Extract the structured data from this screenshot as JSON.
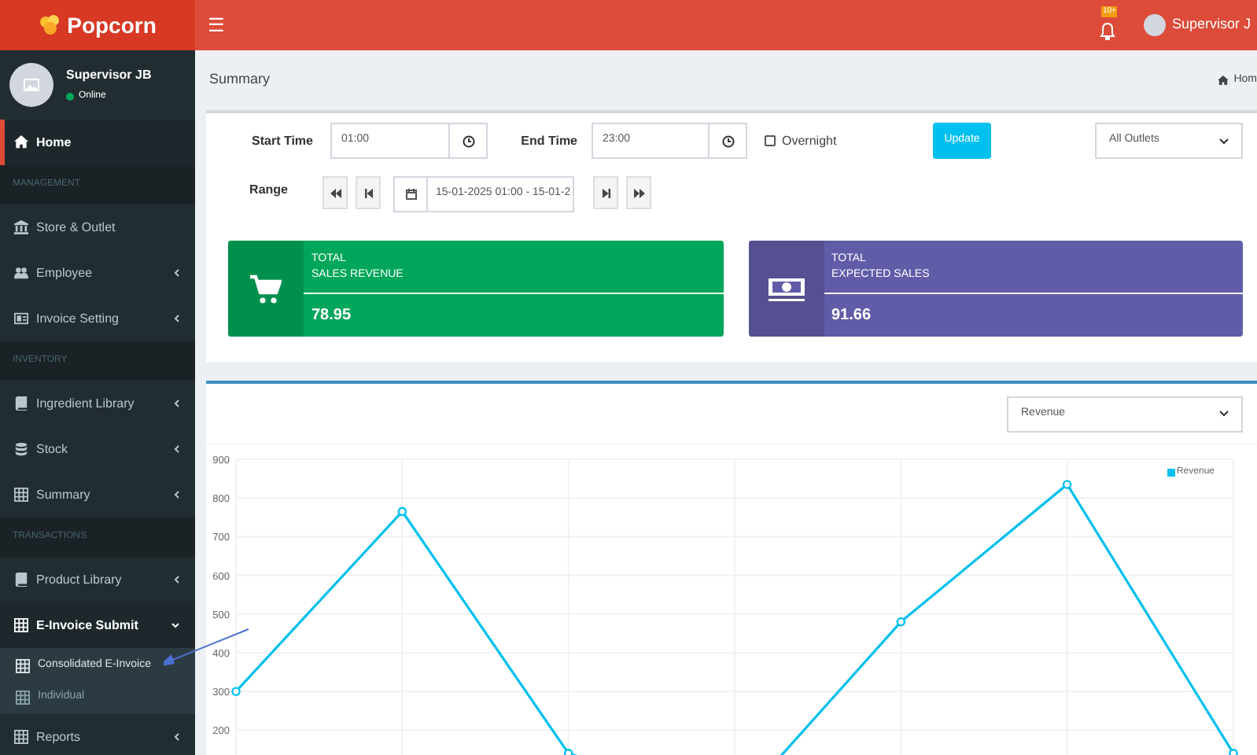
{
  "header": {
    "logo": "Popcorn",
    "menu_toggle": "☰",
    "notifications_badge": "10+",
    "user_name": "Supervisor J"
  },
  "sidebar": {
    "user": {
      "name": "Supervisor JB",
      "status": "Online"
    },
    "items": [
      {
        "kind": "item",
        "label": "Home",
        "selected": true,
        "has_children": false
      },
      {
        "kind": "header",
        "label": "MANAGEMENT"
      },
      {
        "kind": "item",
        "label": "Store & Outlet",
        "selected": false,
        "has_children": false
      },
      {
        "kind": "item",
        "label": "Employee",
        "selected": false,
        "has_children": true,
        "expanded": false
      },
      {
        "kind": "item",
        "label": "Invoice Setting",
        "selected": false,
        "has_children": true,
        "expanded": false
      },
      {
        "kind": "header",
        "label": "INVENTORY"
      },
      {
        "kind": "item",
        "label": "Ingredient Library",
        "selected": false,
        "has_children": true,
        "expanded": false
      },
      {
        "kind": "item",
        "label": "Stock",
        "selected": false,
        "has_children": true,
        "expanded": false
      },
      {
        "kind": "item",
        "label": "Summary",
        "selected": false,
        "has_children": true,
        "expanded": false
      },
      {
        "kind": "header",
        "label": "TRANSACTIONS"
      },
      {
        "kind": "item",
        "label": "Product Library",
        "selected": false,
        "has_children": true,
        "expanded": false
      },
      {
        "kind": "item",
        "label": "E-Invoice Submit",
        "selected": false,
        "has_children": true,
        "expanded": true,
        "children": [
          {
            "label": "Consolidated E-Invoice",
            "selected": true
          },
          {
            "label": "Individual",
            "selected": false
          }
        ]
      },
      {
        "kind": "item",
        "label": "Reports",
        "selected": false,
        "has_children": true,
        "expanded": false
      }
    ]
  },
  "page": {
    "title": "Summary",
    "breadcrumb": "Hom"
  },
  "filters": {
    "start_label": "Start Time",
    "start_value": "01:00",
    "end_label": "End Time",
    "end_value": "23:00",
    "overnight": {
      "label": "Overnight",
      "checked": false
    },
    "update_button": "Update",
    "outlet_select": "All Outlets",
    "range_label": "Range",
    "range_value": "15-01-2025 01:00 - 15-01-2"
  },
  "info_boxes": [
    {
      "kind": "cart",
      "line1": "TOTAL",
      "line2": "SALES REVENUE",
      "value": "78.95",
      "color": "#00a65a"
    },
    {
      "kind": "money",
      "line1": "TOTAL",
      "line2": "EXPECTED SALES",
      "value": "91.66",
      "color": "#605ca8"
    }
  ],
  "chart_panel": {
    "metric_select": "Revenue",
    "chart_data": {
      "type": "line",
      "grid": true,
      "ylim": [
        0,
        900
      ],
      "yticks": [
        200,
        300,
        400,
        500,
        600,
        700,
        800,
        900
      ],
      "series": [
        {
          "name": "Revenue",
          "color": "#00c0ef",
          "marker": true,
          "values": [
            300,
            765,
            140,
            0,
            480,
            835,
            140
          ]
        }
      ]
    }
  }
}
